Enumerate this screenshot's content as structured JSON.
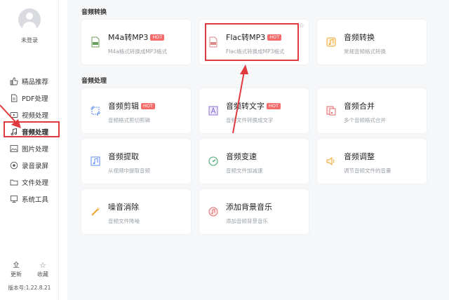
{
  "sidebar": {
    "login_label": "未登录",
    "items": [
      {
        "label": "精品推荐",
        "icon": "thumbs-up-icon"
      },
      {
        "label": "PDF处理",
        "icon": "pdf-icon"
      },
      {
        "label": "视频处理",
        "icon": "video-icon"
      },
      {
        "label": "音频处理",
        "icon": "music-icon",
        "active": true
      },
      {
        "label": "图片处理",
        "icon": "image-icon"
      },
      {
        "label": "录音录屏",
        "icon": "record-icon"
      },
      {
        "label": "文件处理",
        "icon": "folder-icon"
      },
      {
        "label": "系统工具",
        "icon": "toolbox-icon"
      }
    ],
    "footer": {
      "update_label": "更新",
      "favorite_label": "收藏",
      "version": "版本号:1.22.8.21"
    }
  },
  "main": {
    "section_convert": "音频转换",
    "section_process": "音频处理",
    "hot_label": "HOT",
    "cards": [
      {
        "title": "M4a转MP3",
        "desc": "M4a格式转换成MP3格式",
        "hot": true,
        "icon": "mp3-file-icon"
      },
      {
        "title": "Flac转MP3",
        "desc": "Flac格式转换成MP3格式",
        "hot": true,
        "icon": "flac-file-icon"
      },
      {
        "title": "音频转换",
        "desc": "常规音频格式转换",
        "hot": false,
        "icon": "audio-convert-icon"
      },
      {
        "title": "音频剪辑",
        "desc": "音频格式剪切剪辑",
        "hot": true,
        "icon": "audio-cut-icon"
      },
      {
        "title": "音频转文字",
        "desc": "音频文件转换成文字",
        "hot": true,
        "icon": "audio-to-text-icon"
      },
      {
        "title": "音频合并",
        "desc": "多个音频格式合并",
        "hot": false,
        "icon": "audio-merge-icon"
      },
      {
        "title": "音频提取",
        "desc": "从视频中提取音频",
        "hot": false,
        "icon": "audio-extract-icon"
      },
      {
        "title": "音频变速",
        "desc": "音频文件加减速",
        "hot": false,
        "icon": "speed-icon"
      },
      {
        "title": "音频调整",
        "desc": "调节音频文件的音量",
        "hot": false,
        "icon": "volume-icon"
      },
      {
        "title": "噪音消除",
        "desc": "音频文件降噪",
        "hot": false,
        "icon": "noise-reduce-icon"
      },
      {
        "title": "添加背景音乐",
        "desc": "添加音频背景音乐",
        "hot": false,
        "icon": "bg-music-icon"
      }
    ]
  },
  "colors": {
    "accent": "#e0393e",
    "hot": "#f36b6b",
    "icon_blue": "#5b8def",
    "icon_orange": "#f0a732"
  }
}
